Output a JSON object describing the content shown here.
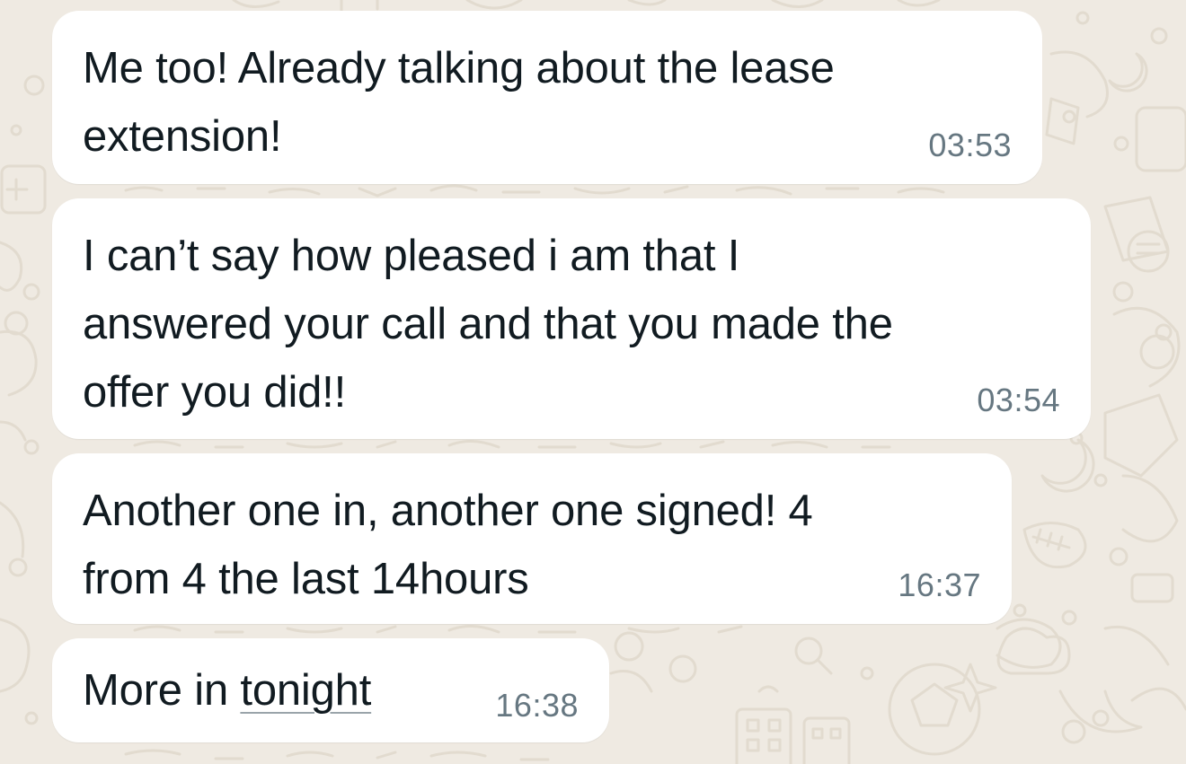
{
  "chat": {
    "messages": [
      {
        "lines": [
          "Me too! Already talking about the lease",
          "extension!"
        ],
        "time": "03:53"
      },
      {
        "lines": [
          "I can’t say how pleased i am that I",
          "answered your call and that you made the",
          "offer you did!!"
        ],
        "time": "03:54"
      },
      {
        "lines": [
          "Another one in, another one signed! 4",
          "from 4 the last 14hours"
        ],
        "time": "16:37"
      },
      {
        "text_prefix": "More in ",
        "link_text": "tonight",
        "time": "16:38"
      }
    ]
  },
  "theme": {
    "wallpaper_color": "#efeae2",
    "doodle_color": "#e2dbcf",
    "bubble_color": "#ffffff",
    "text_color": "#111b21",
    "time_color": "#667781"
  }
}
